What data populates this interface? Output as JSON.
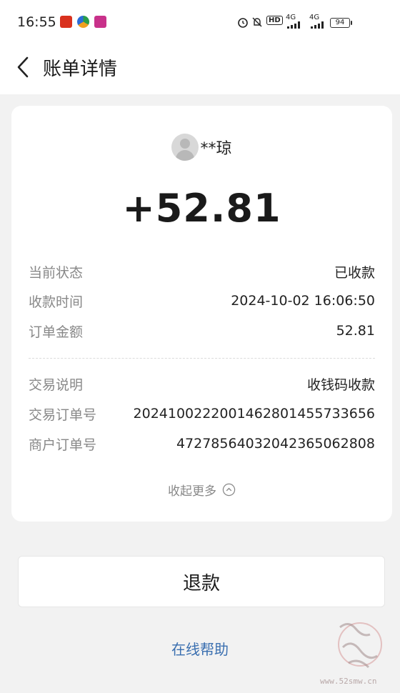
{
  "status_bar": {
    "time": "16:55",
    "network_a": "4G",
    "network_b": "4G",
    "hd": "HD",
    "battery": "94"
  },
  "header": {
    "title": "账单详情"
  },
  "bill": {
    "payer_name": "**琼",
    "amount": "+52.81",
    "rows_top": [
      {
        "key": "当前状态",
        "value": "已收款"
      },
      {
        "key": "收款时间",
        "value": "2024-10-02 16:06:50"
      },
      {
        "key": "订单金额",
        "value": "52.81"
      }
    ],
    "rows_bottom": [
      {
        "key": "交易说明",
        "value": "收钱码收款"
      },
      {
        "key": "交易订单号",
        "value": "20241002220014628014557336​56"
      },
      {
        "key": "商户订单号",
        "value": "4727856403204236506​2808"
      }
    ],
    "collapse_label": "收起更多"
  },
  "actions": {
    "refund_label": "退款",
    "help_label": "在线帮助"
  },
  "watermark": {
    "url": "www.52smw.cn"
  },
  "colors": {
    "accent_link": "#3a6fb0",
    "muted_text": "#888888",
    "background": "#f2f2f2"
  }
}
